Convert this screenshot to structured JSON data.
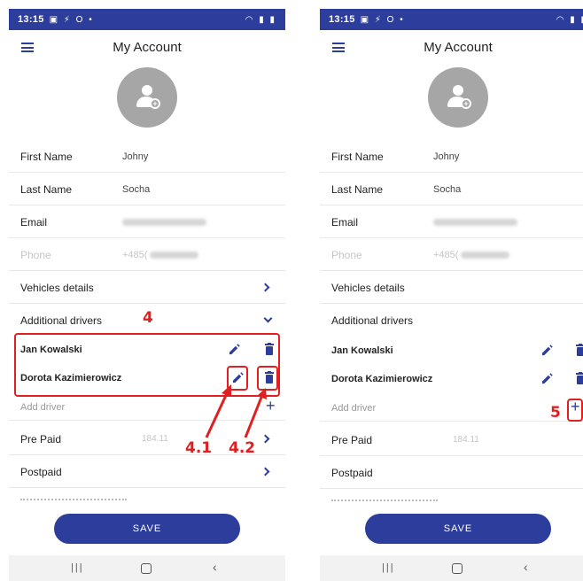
{
  "status_bar": {
    "time": "13:15",
    "left_icons": "▣ ⚡ O •",
    "right_icons": "◠ ▮ ▮"
  },
  "header": {
    "title": "My Account"
  },
  "fields": [
    {
      "label": "First Name",
      "value": "Johny"
    },
    {
      "label": "Last Name",
      "value": "Socha"
    },
    {
      "label": "Email",
      "value": ""
    },
    {
      "label": "Phone",
      "value": "+485("
    }
  ],
  "sections": {
    "vehicles": "Vehicles details",
    "additional_drivers": "Additional drivers",
    "pre_paid": "Pre Paid",
    "pre_paid_amount": "184.11",
    "postpaid": "Postpaid"
  },
  "drivers": [
    {
      "name": "Jan Kowalski"
    },
    {
      "name": "Dorota  Kazimierowicz"
    }
  ],
  "add_driver": {
    "label": "Add driver",
    "icon": "plus-icon"
  },
  "save_button": {
    "label": "SAVE"
  },
  "nav_bar": {
    "recents": "|||",
    "back": "‹"
  },
  "annotations": {
    "left": {
      "box_label": "4",
      "edit_label": "4.1",
      "delete_label": "4.2"
    },
    "right": {
      "add_label": "5"
    }
  },
  "colors": {
    "primary": "#2c3d9c",
    "annotation": "#e02020",
    "avatar": "#a6a6a6"
  }
}
